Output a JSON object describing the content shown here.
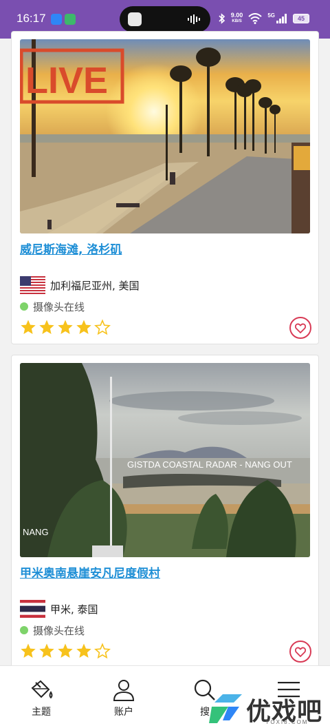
{
  "status_bar": {
    "time": "16:17",
    "net_speed_value": "9.00",
    "net_speed_unit": "KB/S",
    "signal_label": "5G",
    "battery": "45"
  },
  "colors": {
    "status_bar": "#7a4fb0",
    "link": "#1f8fd6",
    "star": "#f7c21c",
    "heart": "#d83a55",
    "online": "#7ed36a"
  },
  "cards": [
    {
      "title": "威尼斯海滩, 洛杉矶",
      "location": "加利福尼亚州, 美国",
      "status": "摄像头在线",
      "rating": 4,
      "rating_max": 5,
      "flag": "us-flag",
      "image_overlay": "LIVE"
    },
    {
      "title": "甲米奥南悬崖安凡尼度假村",
      "location": "甲米, 泰国",
      "status": "摄像头在线",
      "rating": 4,
      "rating_max": 5,
      "flag": "thai-flag",
      "image_overlay": "GISTDA COASTAL RADAR - NANG OUT",
      "image_corner_label": "NANG"
    }
  ],
  "bottom_nav": {
    "items": [
      {
        "label": "主题",
        "icon": "paint-bucket-icon"
      },
      {
        "label": "账户",
        "icon": "user-icon"
      },
      {
        "label": "搜",
        "icon": "search-icon"
      },
      {
        "label": "",
        "icon": "menu-icon"
      }
    ]
  },
  "watermark": {
    "text": "优戏吧",
    "sub": "YOXI8.COM"
  }
}
